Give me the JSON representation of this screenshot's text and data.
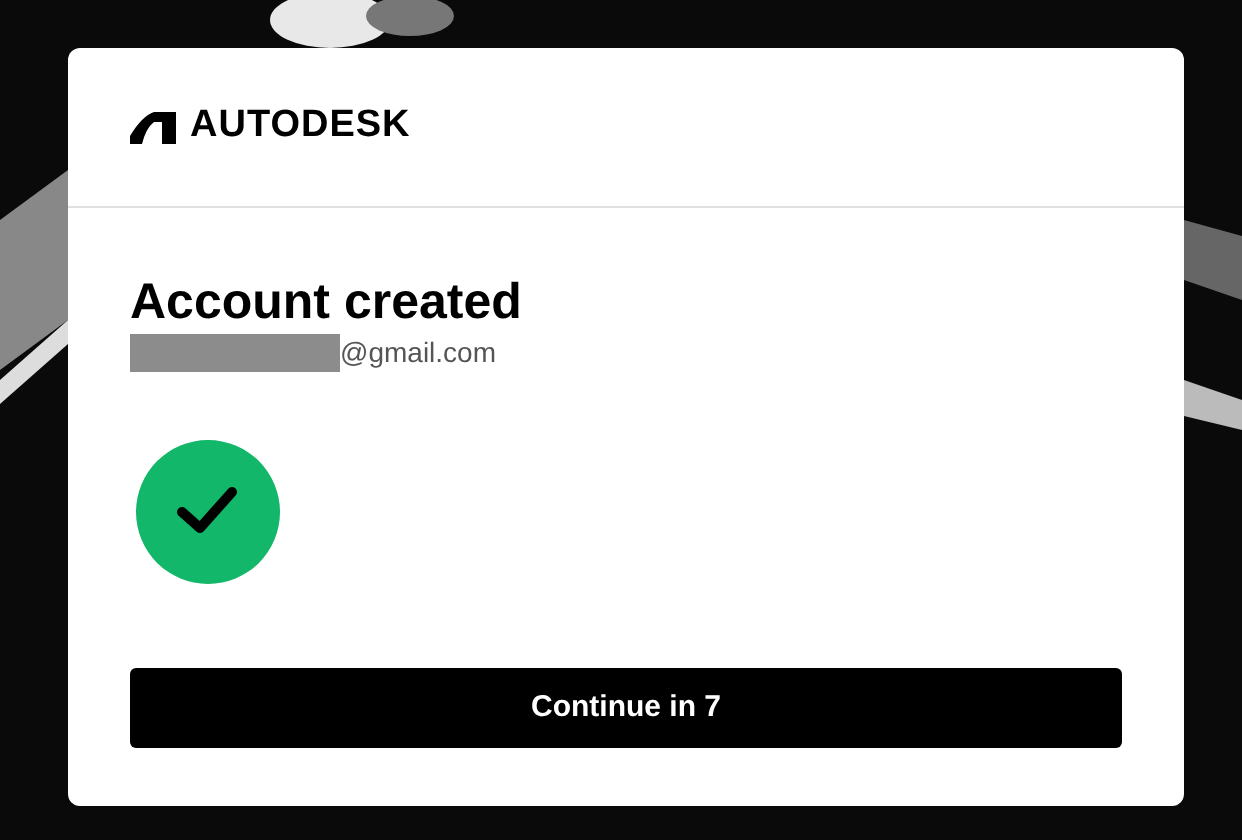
{
  "brand": {
    "name": "AUTODESK"
  },
  "heading": "Account created",
  "email": "@gmail.com",
  "button": {
    "label": "Continue in 7"
  }
}
